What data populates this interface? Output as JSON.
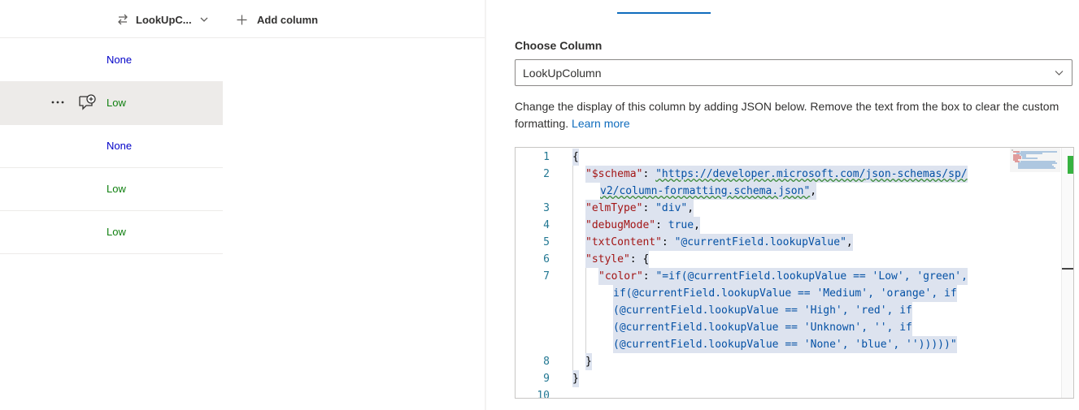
{
  "list": {
    "header": {
      "lookup_column": "LookUpC...",
      "add_column": "Add column"
    },
    "rows": [
      {
        "value": "None",
        "color": "#0000c8"
      },
      {
        "value": "Low",
        "color": "#108010"
      },
      {
        "value": "None",
        "color": "#0000c8"
      },
      {
        "value": "Low",
        "color": "#108010"
      },
      {
        "value": "Low",
        "color": "#108010"
      }
    ]
  },
  "panel": {
    "choose_label": "Choose Column",
    "selected_column": "LookUpColumn",
    "description": "Change the display of this column by adding JSON below. Remove the text from the box to clear the custom formatting.",
    "learn_more": "Learn more",
    "accent": "#0f6cbd"
  },
  "editor": {
    "line_numbers": [
      "1",
      "2",
      "3",
      "4",
      "5",
      "6",
      "7",
      "8",
      "9",
      "10"
    ],
    "lines": {
      "l1": "{",
      "l2a_key": "\"$schema\"",
      "l2a_sep": ": ",
      "l2a_val": "\"https://developer.microsoft.com/json-schemas/sp/",
      "l2b_val": "v2/column-formatting.schema.json\"",
      "l2b_end": ",",
      "l3_key": "\"elmType\"",
      "l3_sep": ": ",
      "l3_val": "\"div\"",
      "l3_end": ",",
      "l4_key": "\"debugMode\"",
      "l4_sep": ": ",
      "l4_val": "true",
      "l4_end": ",",
      "l5_key": "\"txtContent\"",
      "l5_sep": ": ",
      "l5_val": "\"@currentField.lookupValue\"",
      "l5_end": ",",
      "l6_key": "\"style\"",
      "l6_sep": ": {",
      "l7_key": "\"color\"",
      "l7_sep": ": ",
      "l7_val": "\"=if(@currentField.lookupValue == 'Low', 'green',",
      "l7b_val": "if(@currentField.lookupValue == 'Medium', 'orange', if",
      "l7c_val": "(@currentField.lookupValue == 'High', 'red', if",
      "l7d_val": "(@currentField.lookupValue == 'Unknown', '', if",
      "l7e_val": "(@currentField.lookupValue == 'None', 'blue', '')))))\"",
      "l8": "}",
      "l9": "}"
    }
  },
  "icons": {
    "lookup": "lookup-arrows-icon",
    "chevron": "chevron-down-icon",
    "add": "plus-icon",
    "more": "more-icon",
    "comment": "comment-add-icon"
  }
}
